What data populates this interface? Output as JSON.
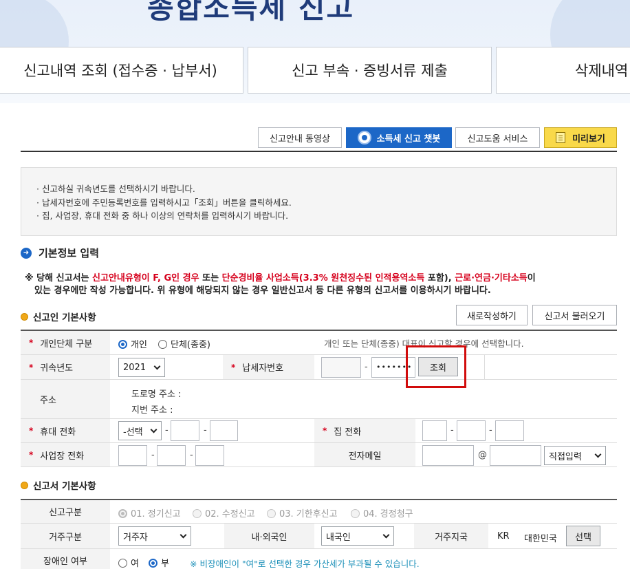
{
  "banner": {
    "title": "종합소득세 신고"
  },
  "menu_tabs": [
    {
      "label": "신고내역 조회 (접수증 · 납부서)"
    },
    {
      "label": "신고 부속 · 증빙서류 제출"
    },
    {
      "label": "삭제내역"
    }
  ],
  "toolbar": {
    "video_label": "신고안내 동영상",
    "chatbot_label": "소득세 신고 챗봇",
    "help_label": "신고도움 서비스",
    "preview_label": "미리보기"
  },
  "notice": [
    "· 신고하실 귀속년도를 선택하시기 바랍니다.",
    "· 납세자번호에 주민등록번호를 입력하시고「조회」버튼을 클릭하세요.",
    "· 집, 사업장, 휴대 전화 중 하나 이상의 연락처를 입력하시기 바랍니다."
  ],
  "section_basic": {
    "title": "기본정보 입력"
  },
  "warning": {
    "prefix": "※ 당해 신고서는 ",
    "red1": "신고안내유형이 F, G인 경우",
    "mid1": " 또는 ",
    "red2": "단순경비율 사업소득(3.3% 원천징수된 인적용역소득",
    "mid2": " 포함), ",
    "red3": "근로·연금·기타소득",
    "mid3": "이",
    "line2": "있는 경우에만 작성 가능합니다. 위 유형에 해당되지 않는 경우 일반신고서 등 다른 유형의 신고서를 이용하시기 바랍니다."
  },
  "reporter": {
    "title": "신고인 기본사항",
    "new_btn": "새로작성하기",
    "load_btn": "신고서 불러오기",
    "type_label": "개인단체 구분",
    "type_opt_individual": "개인",
    "type_opt_group": "단체(종중)",
    "type_hint": "개인 또는 단체(종중) 대표이 신고할 경우에 선택합니다.",
    "year_label": "귀속년도",
    "year_value": "2021",
    "taxpayer_label": "납세자번호",
    "taxpayer_front": "",
    "taxpayer_back": "•••••••",
    "lookup_btn": "조회",
    "address_label": "주소",
    "road_address": "도로명 주소 :",
    "lot_address": "지번 주소 :",
    "mobile_label": "휴대 전화",
    "mobile_select": "-선택",
    "home_label": "집 전화",
    "biz_label": "사업장 전화",
    "email_label": "전자메일",
    "email_at": "@",
    "email_domain_select": "직접입력",
    "required_mark": "*",
    "dash": "-"
  },
  "report_basic": {
    "title": "신고서 기본사항",
    "kind_label": "신고구분",
    "kind_options": [
      "01. 정기신고",
      "02. 수정신고",
      "03. 기한후신고",
      "04. 경정청구"
    ],
    "residence_label": "거주구분",
    "residence_value": "거주자",
    "nationality_label": "내·외국인",
    "nationality_value": "내국인",
    "country_label": "거주지국",
    "country_code": "KR",
    "country_name": "대한민국",
    "country_btn": "선택",
    "disabled_label": "장애인 여부",
    "disabled_yes": "여",
    "disabled_no": "부",
    "disabled_note": "※ 비장애인이 \"여\"로 선택한 경우 가산세가 부과될 수 있습니다."
  },
  "colors": {
    "accent_blue": "#1c67c7",
    "required_red": "#d6001c",
    "highlight_red": "#d10c0c",
    "preview_yellow": "#f9d94a"
  }
}
